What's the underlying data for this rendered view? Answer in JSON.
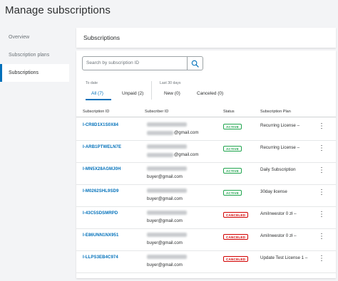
{
  "page": {
    "title": "Manage subscriptions"
  },
  "sidebar": {
    "items": [
      {
        "label": "Overview"
      },
      {
        "label": "Subscription plans"
      },
      {
        "label": "Subscriptions"
      }
    ]
  },
  "header_card": {
    "title": "Subscriptions"
  },
  "search": {
    "placeholder": "Search by subscription ID"
  },
  "filters": {
    "to_date_label": "To date",
    "last30_label": "Last 30 days",
    "tabs": [
      {
        "label": "All (7)"
      },
      {
        "label": "Unpaid (2)"
      },
      {
        "label": "New (0)"
      },
      {
        "label": "Canceled (0)"
      }
    ]
  },
  "table": {
    "columns": [
      "Subscription ID",
      "Subscriber ID",
      "Status",
      "Subscription Plan"
    ],
    "rows": [
      {
        "id": "I-CR8D1X1S0X84",
        "email": "@gmail.com",
        "status": "ACTIVE",
        "plan": "Recurring License –"
      },
      {
        "id": "I-ARB1PTWELN7E",
        "email": "@gmail.com",
        "status": "ACTIVE",
        "plan": "Recurring License –"
      },
      {
        "id": "I-MN5X28AGMJ0H",
        "email": "buyer@gmail.com",
        "status": "ACTIVE",
        "plan": "Daily Subscription"
      },
      {
        "id": "I-M0262SHL9SD9",
        "email": "buyer@gmail.com",
        "status": "ACTIVE",
        "plan": "30day license"
      },
      {
        "id": "I-43C5SDSMRPD",
        "email": "buyer@gmail.com",
        "status": "CANCELED",
        "plan": "AmiInwestor 0 zł –"
      },
      {
        "id": "I-E86UNN1NX951",
        "email": "buyer@gmail.com",
        "status": "CANCELED",
        "plan": "AmiInwestor 0 zł –"
      },
      {
        "id": "I-LLPS3EB4C974",
        "email": "buyer@gmail.com",
        "status": "CANCELED",
        "plan": "Update Test License 1 –"
      }
    ]
  },
  "icons": {
    "search": "search-icon",
    "row_menu": "kebab-menu-icon"
  },
  "colors": {
    "accent": "#0070ba",
    "active": "#21a54f",
    "canceled": "#d20000"
  }
}
